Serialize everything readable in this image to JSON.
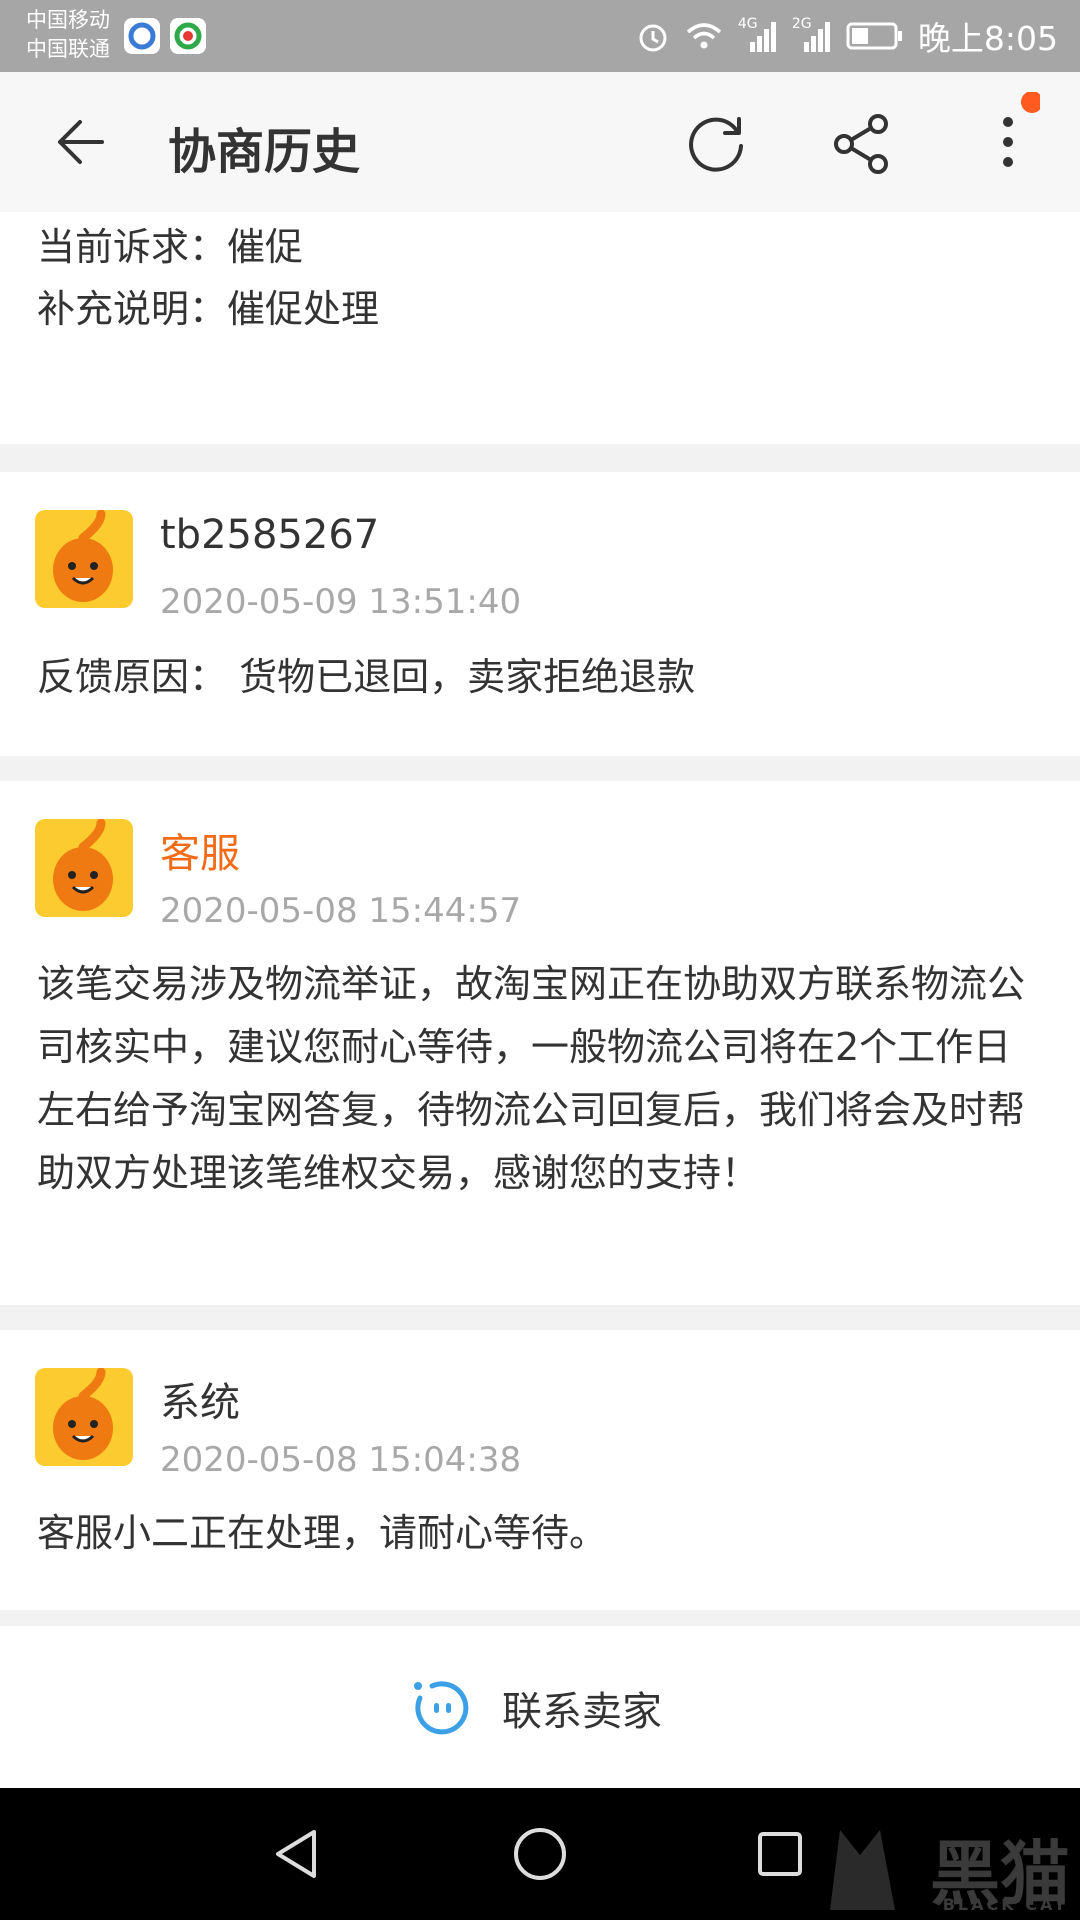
{
  "status_bar": {
    "carrier1": "中国移动",
    "carrier2": "中国联通",
    "network1": "4G",
    "network2": "2G",
    "time": "晚上8:05"
  },
  "header": {
    "title": "协商历史"
  },
  "top_card": {
    "line1": "当前诉求：催促",
    "line2": "补充说明：催促处理"
  },
  "messages": [
    {
      "user": "tb2585267",
      "time": "2020-05-09 13:51:40",
      "text": "反馈原因：  货物已退回，卖家拒绝退款"
    },
    {
      "user": "客服",
      "time": "2020-05-08 15:44:57",
      "text": "该笔交易涉及物流举证，故淘宝网正在协助双方联系物流公司核实中，建议您耐心等待，一般物流公司将在2个工作日左右给予淘宝网答复，待物流公司回复后，我们将会及时帮助双方处理该笔维权交易，感谢您的支持！"
    },
    {
      "user": "系统",
      "time": "2020-05-08 15:04:38",
      "text": "客服小二正在处理，请耐心等待。"
    }
  ],
  "footer": {
    "contact_label": "联系卖家"
  },
  "watermark": {
    "text": "黑猫",
    "sub": "BLACK CAT"
  },
  "colors": {
    "accent_orange": "#f26b19",
    "avatar_yellow": "#fbcb2f",
    "contact_blue": "#3ca0e6",
    "notify_dot": "#ff5a1f"
  }
}
